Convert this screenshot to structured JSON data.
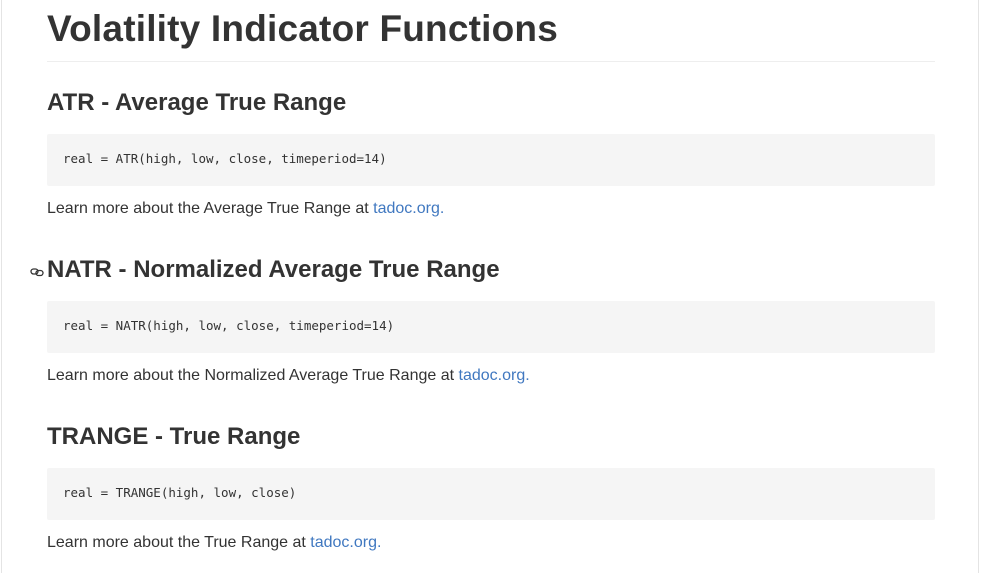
{
  "title": "Volatility Indicator Functions",
  "sections": [
    {
      "heading": "ATR - Average True Range",
      "code": "real = ATR(high, low, close, timeperiod=14)",
      "text": "Learn more about the Average True Range at ",
      "link": "tadoc.org",
      "after": "."
    },
    {
      "heading": "NATR - Normalized Average True Range",
      "code": "real = NATR(high, low, close, timeperiod=14)",
      "text": "Learn more about the Normalized Average True Range at ",
      "link": "tadoc.org",
      "after": "."
    },
    {
      "heading": "TRANGE - True Range",
      "code": "real = TRANGE(high, low, close)",
      "text": "Learn more about the True Range at ",
      "link": "tadoc.org",
      "after": "."
    }
  ],
  "colors": {
    "link": "#4078c0",
    "code_bg": "#f5f5f5",
    "text": "#333333"
  },
  "icons": {
    "anchor": "link-icon"
  }
}
